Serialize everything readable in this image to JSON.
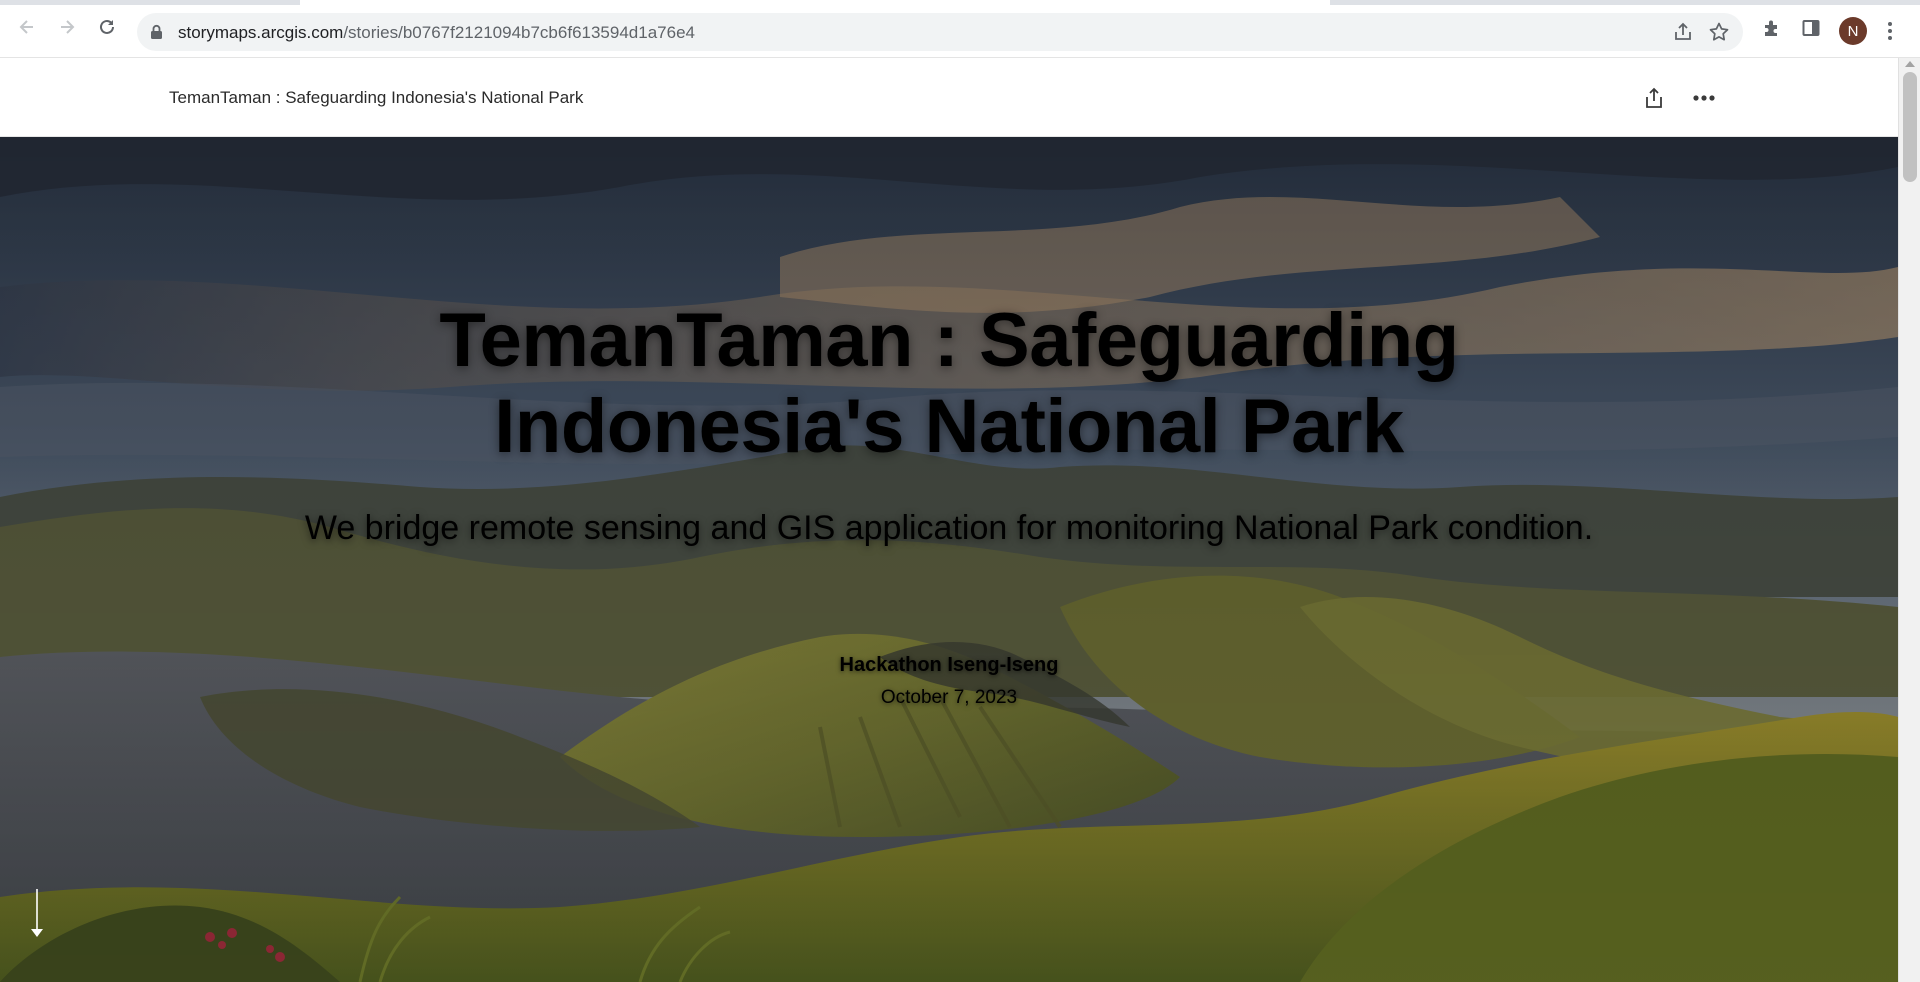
{
  "browser": {
    "url_host": "storymaps.arcgis.com",
    "url_path": "/stories/b0767f2121094b7cb6f613594d1a76e4",
    "profile_initial": "N",
    "icons": [
      "back-icon",
      "forward-icon",
      "reload-icon",
      "lock-icon",
      "share-icon",
      "star-icon",
      "extensions-icon",
      "side-panel-icon",
      "menu-icon"
    ]
  },
  "story_header": {
    "title": "TemanTaman : Safeguarding Indonesia's National Park",
    "icons": [
      "share-icon",
      "more-icon"
    ]
  },
  "hero": {
    "title": "TemanTaman : Safeguarding Indonesia's National Park",
    "subtitle": "We bridge remote sensing and GIS application for monitoring National Park condition.",
    "author": "Hackathon Iseng-Iseng",
    "date": "October 7, 2023"
  },
  "colors": {
    "hero_text": "#ffffff",
    "avatar_bg": "#6b3a2a"
  }
}
